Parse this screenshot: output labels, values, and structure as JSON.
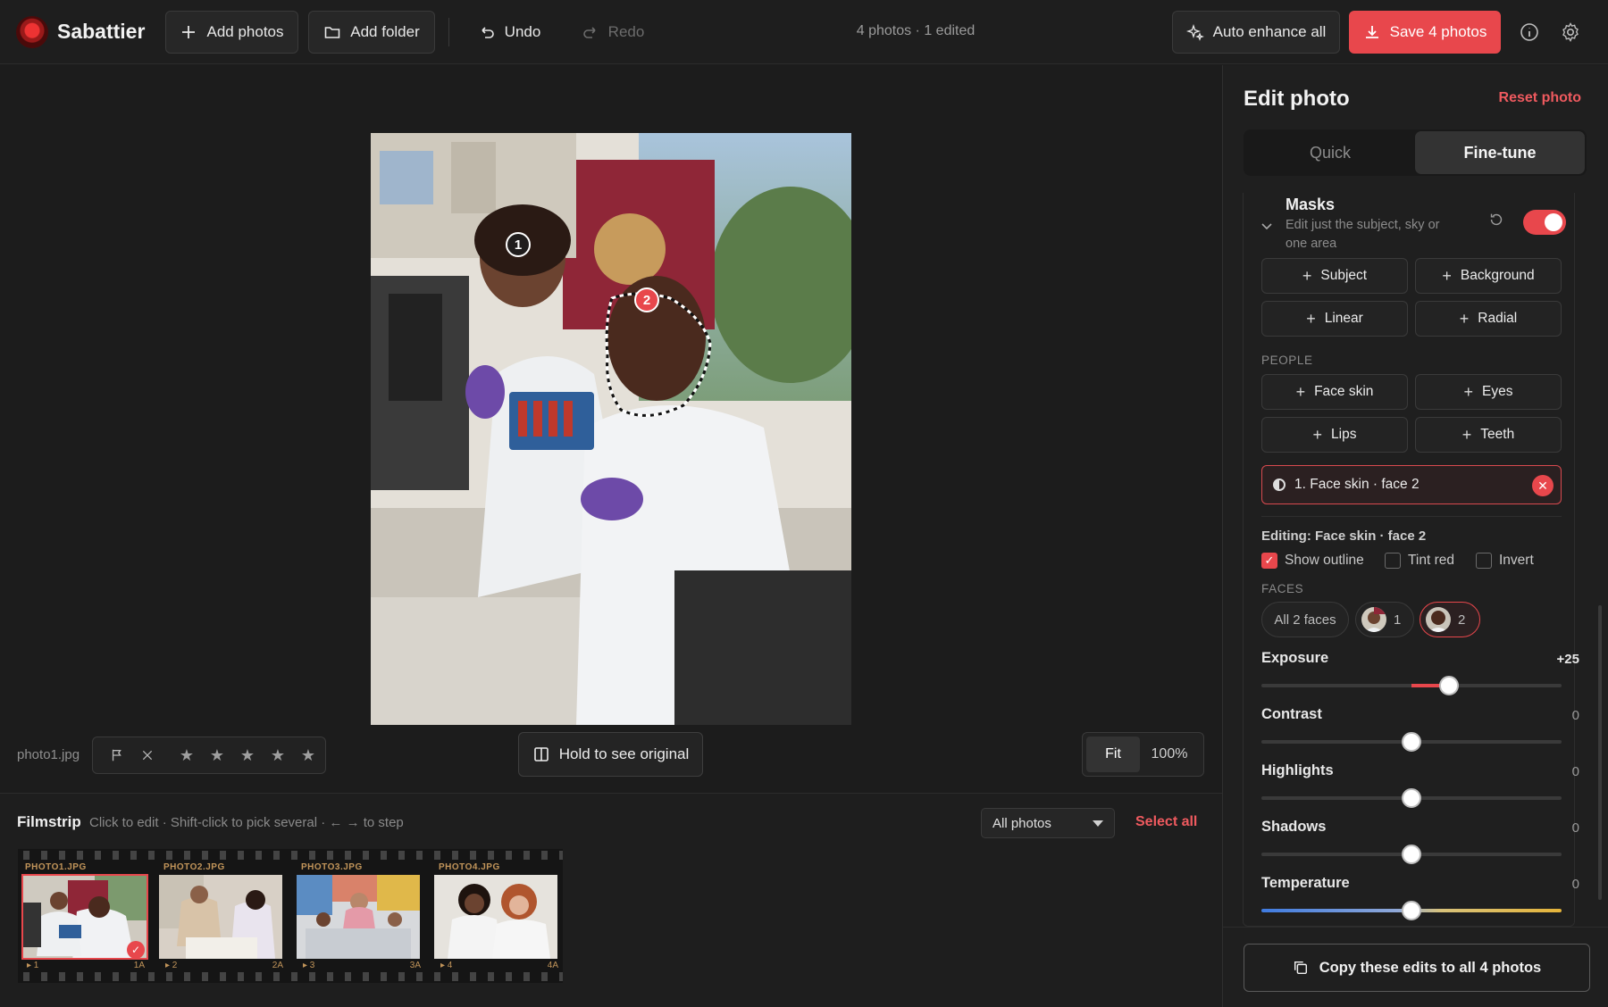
{
  "app": {
    "name": "Sabattier"
  },
  "toolbar": {
    "add_photos": "Add photos",
    "add_folder": "Add folder",
    "undo": "Undo",
    "redo": "Redo",
    "status": "4 photos · 1 edited",
    "auto_enhance": "Auto enhance all",
    "save": "Save 4 photos",
    "info_icon": "info-icon",
    "settings_icon": "gear-icon"
  },
  "canvas": {
    "filename": "photo1.jpg",
    "face_pins": [
      "1",
      "2"
    ],
    "stars": [
      "★",
      "★",
      "★",
      "★",
      "★"
    ],
    "hold_original": "Hold to see original",
    "zoom": {
      "fit": "Fit",
      "full": "100%"
    }
  },
  "filmstrip": {
    "title": "Filmstrip",
    "hint": "Click to edit · Shift-click to pick several · ← → to step",
    "filter": "All photos",
    "select_all": "Select all",
    "frames": [
      {
        "label": "PHOTO1.JPG",
        "num": "▸ 1",
        "code": "1A",
        "selected": true
      },
      {
        "label": "PHOTO2.JPG",
        "num": "▸ 2",
        "code": "2A",
        "selected": false
      },
      {
        "label": "PHOTO3.JPG",
        "num": "▸ 3",
        "code": "3A",
        "selected": false
      },
      {
        "label": "PHOTO4.JPG",
        "num": "▸ 4",
        "code": "4A",
        "selected": false
      }
    ]
  },
  "panel": {
    "title": "Edit photo",
    "reset": "Reset photo",
    "tabs": {
      "quick": "Quick",
      "finetune": "Fine-tune",
      "active": "Fine-tune"
    },
    "masks": {
      "title": "Masks",
      "subtitle": "Edit just the subject, sky or one area",
      "enabled": true,
      "add_buttons": [
        "Subject",
        "Background",
        "Linear",
        "Radial"
      ],
      "people_label": "PEOPLE",
      "people_buttons": [
        "Face skin",
        "Eyes",
        "Lips",
        "Teeth"
      ],
      "active_mask": "1. Face skin · face 2",
      "editing_label": "Editing: Face skin · face 2",
      "options": [
        {
          "label": "Show outline",
          "checked": true
        },
        {
          "label": "Tint red",
          "checked": false
        },
        {
          "label": "Invert",
          "checked": false
        }
      ],
      "faces_label": "FACES",
      "faces": {
        "all": "All 2 faces",
        "face1": "1",
        "face2": "2",
        "selected": "2"
      }
    },
    "sliders": [
      {
        "label": "Exposure",
        "value": "+25",
        "level": 0.625
      },
      {
        "label": "Contrast",
        "value": "0",
        "level": 0.5
      },
      {
        "label": "Highlights",
        "value": "0",
        "level": 0.5
      },
      {
        "label": "Shadows",
        "value": "0",
        "level": 0.5
      },
      {
        "label": "Temperature",
        "value": "0",
        "level": 0.5
      }
    ],
    "copy_button": "Copy these edits to all 4 photos"
  }
}
